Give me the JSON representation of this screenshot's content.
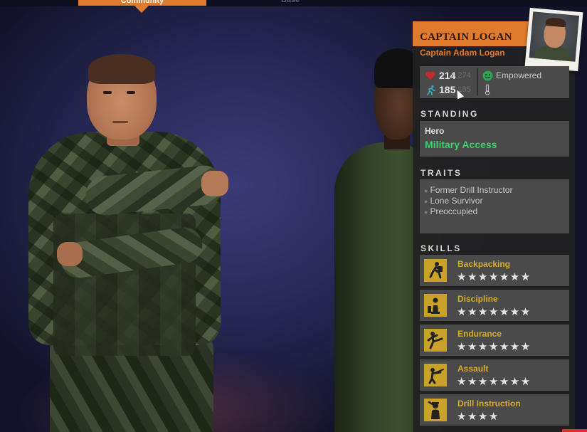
{
  "nav": {
    "tabs": [
      {
        "label": "Community",
        "active": true
      },
      {
        "label": "Base",
        "active": false
      }
    ],
    "accent_color": "#e07a2c"
  },
  "character": {
    "title": "CAPTAIN LOGAN",
    "full_name": "Captain Adam Logan",
    "portrait_icon": "survivor-portrait"
  },
  "stats": {
    "health": {
      "icon": "heart-icon",
      "value": "214",
      "max": "274"
    },
    "stamina": {
      "icon": "runner-icon",
      "value": "185",
      "max": "185"
    },
    "status": {
      "icon": "smiley-icon",
      "label": "Empowered",
      "color": "#3ad06a"
    },
    "condition": {
      "icon": "thermometer-icon"
    }
  },
  "standing": {
    "heading": "STANDING",
    "rank": "Hero",
    "access": "Military Access",
    "access_color": "#3ad06a"
  },
  "traits": {
    "heading": "TRAITS",
    "items": [
      "Former Drill Instructor",
      "Lone Survivor",
      "Preoccupied"
    ]
  },
  "skills": {
    "heading": "SKILLS",
    "items": [
      {
        "name": "Backpacking",
        "icon": "backpacker-icon",
        "stars_filled": 7,
        "stars_total": 7
      },
      {
        "name": "Discipline",
        "icon": "chess-icon",
        "stars_filled": 7,
        "stars_total": 7
      },
      {
        "name": "Endurance",
        "icon": "kick-icon",
        "stars_filled": 7,
        "stars_total": 7
      },
      {
        "name": "Assault",
        "icon": "soldier-icon",
        "stars_filled": 7,
        "stars_total": 7
      },
      {
        "name": "Drill Instruction",
        "icon": "salute-icon",
        "stars_filled": 4,
        "stars_total": 4
      }
    ],
    "skill_color": "#d4ac2c"
  }
}
